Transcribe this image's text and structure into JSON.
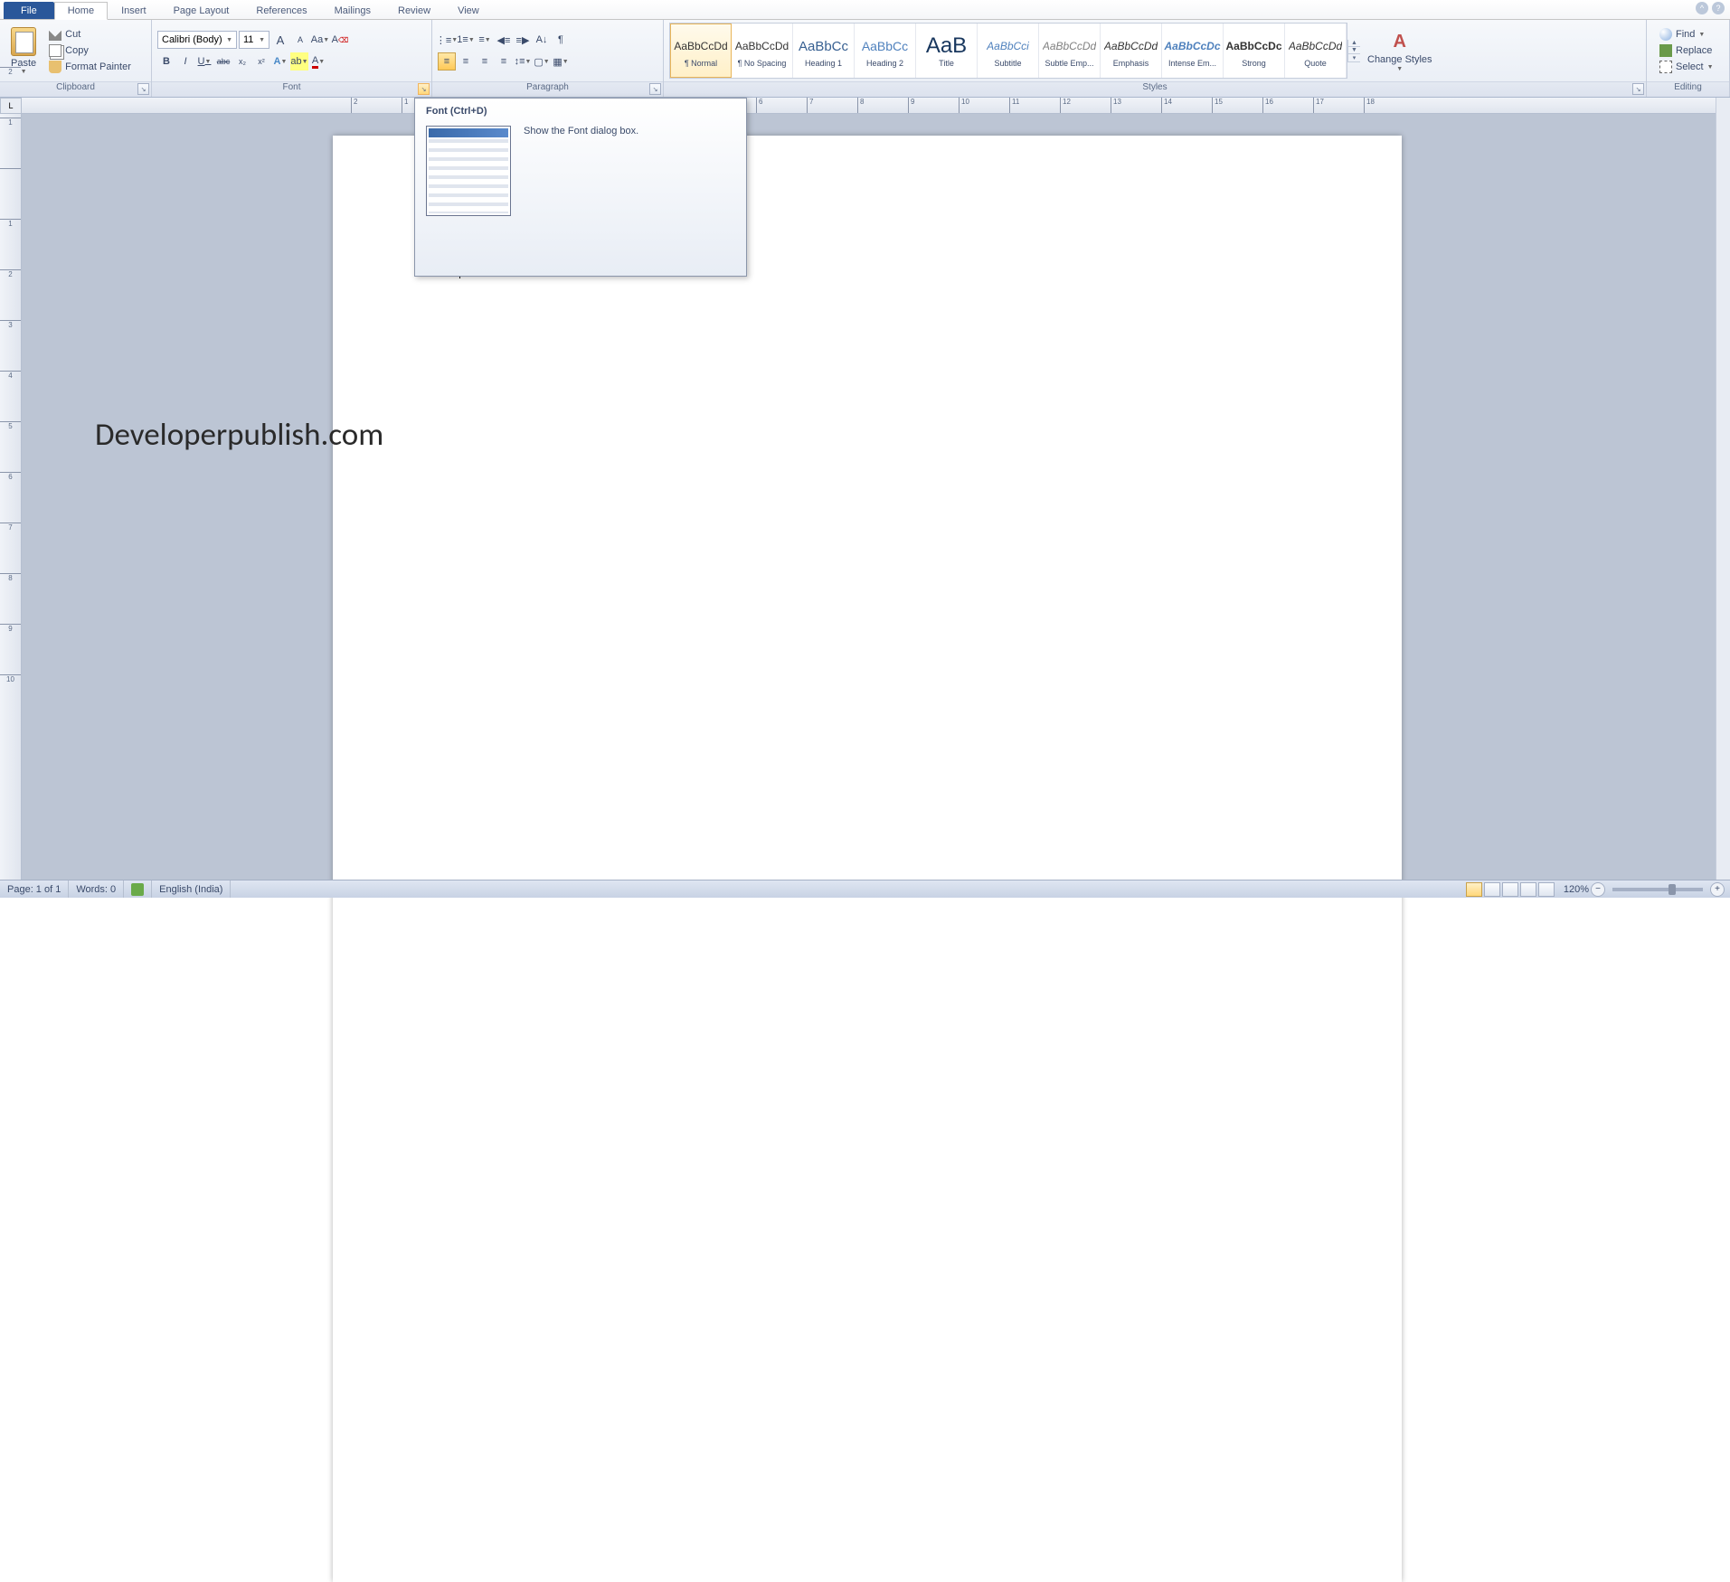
{
  "tabs": {
    "file": "File",
    "items": [
      "Home",
      "Insert",
      "Page Layout",
      "References",
      "Mailings",
      "Review",
      "View"
    ],
    "active": "Home"
  },
  "clipboard": {
    "paste": "Paste",
    "cut": "Cut",
    "copy": "Copy",
    "format_painter": "Format Painter",
    "label": "Clipboard"
  },
  "font": {
    "name": "Calibri (Body)",
    "size": "11",
    "label": "Font",
    "grow": "A",
    "shrink": "A",
    "case": "Aa",
    "clear": "⌫",
    "bold": "B",
    "italic": "I",
    "underline": "U",
    "strike": "abc",
    "sub": "x₂",
    "sup": "x²",
    "effects": "A",
    "highlight": "ab",
    "color": "A"
  },
  "paragraph": {
    "label": "Paragraph",
    "bullets": "⋮≡",
    "numbers": "1≡",
    "multi": "≡",
    "dec_indent": "◀≡",
    "inc_indent": "≡▶",
    "sort": "A↓",
    "marks": "¶",
    "align_l": "≡",
    "align_c": "≡",
    "align_r": "≡",
    "justify": "≡",
    "spacing": "↕≡",
    "shading": "▢",
    "borders": "▦"
  },
  "styles": {
    "label": "Styles",
    "items": [
      {
        "preview": "AaBbCcDd",
        "name": "¶ Normal",
        "selected": true,
        "css": "font-size:12px;"
      },
      {
        "preview": "AaBbCcDd",
        "name": "¶ No Spacing",
        "css": "font-size:12px;"
      },
      {
        "preview": "AaBbCc",
        "name": "Heading 1",
        "css": "font-size:15px;color:#365f91;"
      },
      {
        "preview": "AaBbCc",
        "name": "Heading 2",
        "css": "font-size:14px;color:#4f81bd;"
      },
      {
        "preview": "AaB",
        "name": "Title",
        "css": "font-size:24px;color:#17365d;"
      },
      {
        "preview": "AaBbCci",
        "name": "Subtitle",
        "css": "font-size:12px;font-style:italic;color:#4f81bd;"
      },
      {
        "preview": "AaBbCcDd",
        "name": "Subtle Emp...",
        "css": "font-size:12px;font-style:italic;color:#808080;"
      },
      {
        "preview": "AaBbCcDd",
        "name": "Emphasis",
        "css": "font-size:12px;font-style:italic;"
      },
      {
        "preview": "AaBbCcDc",
        "name": "Intense Em...",
        "css": "font-size:12px;font-style:italic;font-weight:bold;color:#4f81bd;"
      },
      {
        "preview": "AaBbCcDc",
        "name": "Strong",
        "css": "font-size:12px;font-weight:bold;"
      },
      {
        "preview": "AaBbCcDd",
        "name": "Quote",
        "css": "font-size:12px;font-style:italic;"
      }
    ],
    "change": "Change Styles"
  },
  "editing": {
    "label": "Editing",
    "find": "Find",
    "replace": "Replace",
    "select": "Select"
  },
  "tooltip": {
    "title": "Font (Ctrl+D)",
    "desc": "Show the Font dialog box."
  },
  "ruler": {
    "h_start": -2,
    "h_end": 18,
    "v_start": -2,
    "v_end": 10
  },
  "watermark": "Developerpublish.com",
  "status": {
    "page": "Page: 1 of 1",
    "words": "Words: 0",
    "lang": "English (India)",
    "zoom": "120%"
  }
}
